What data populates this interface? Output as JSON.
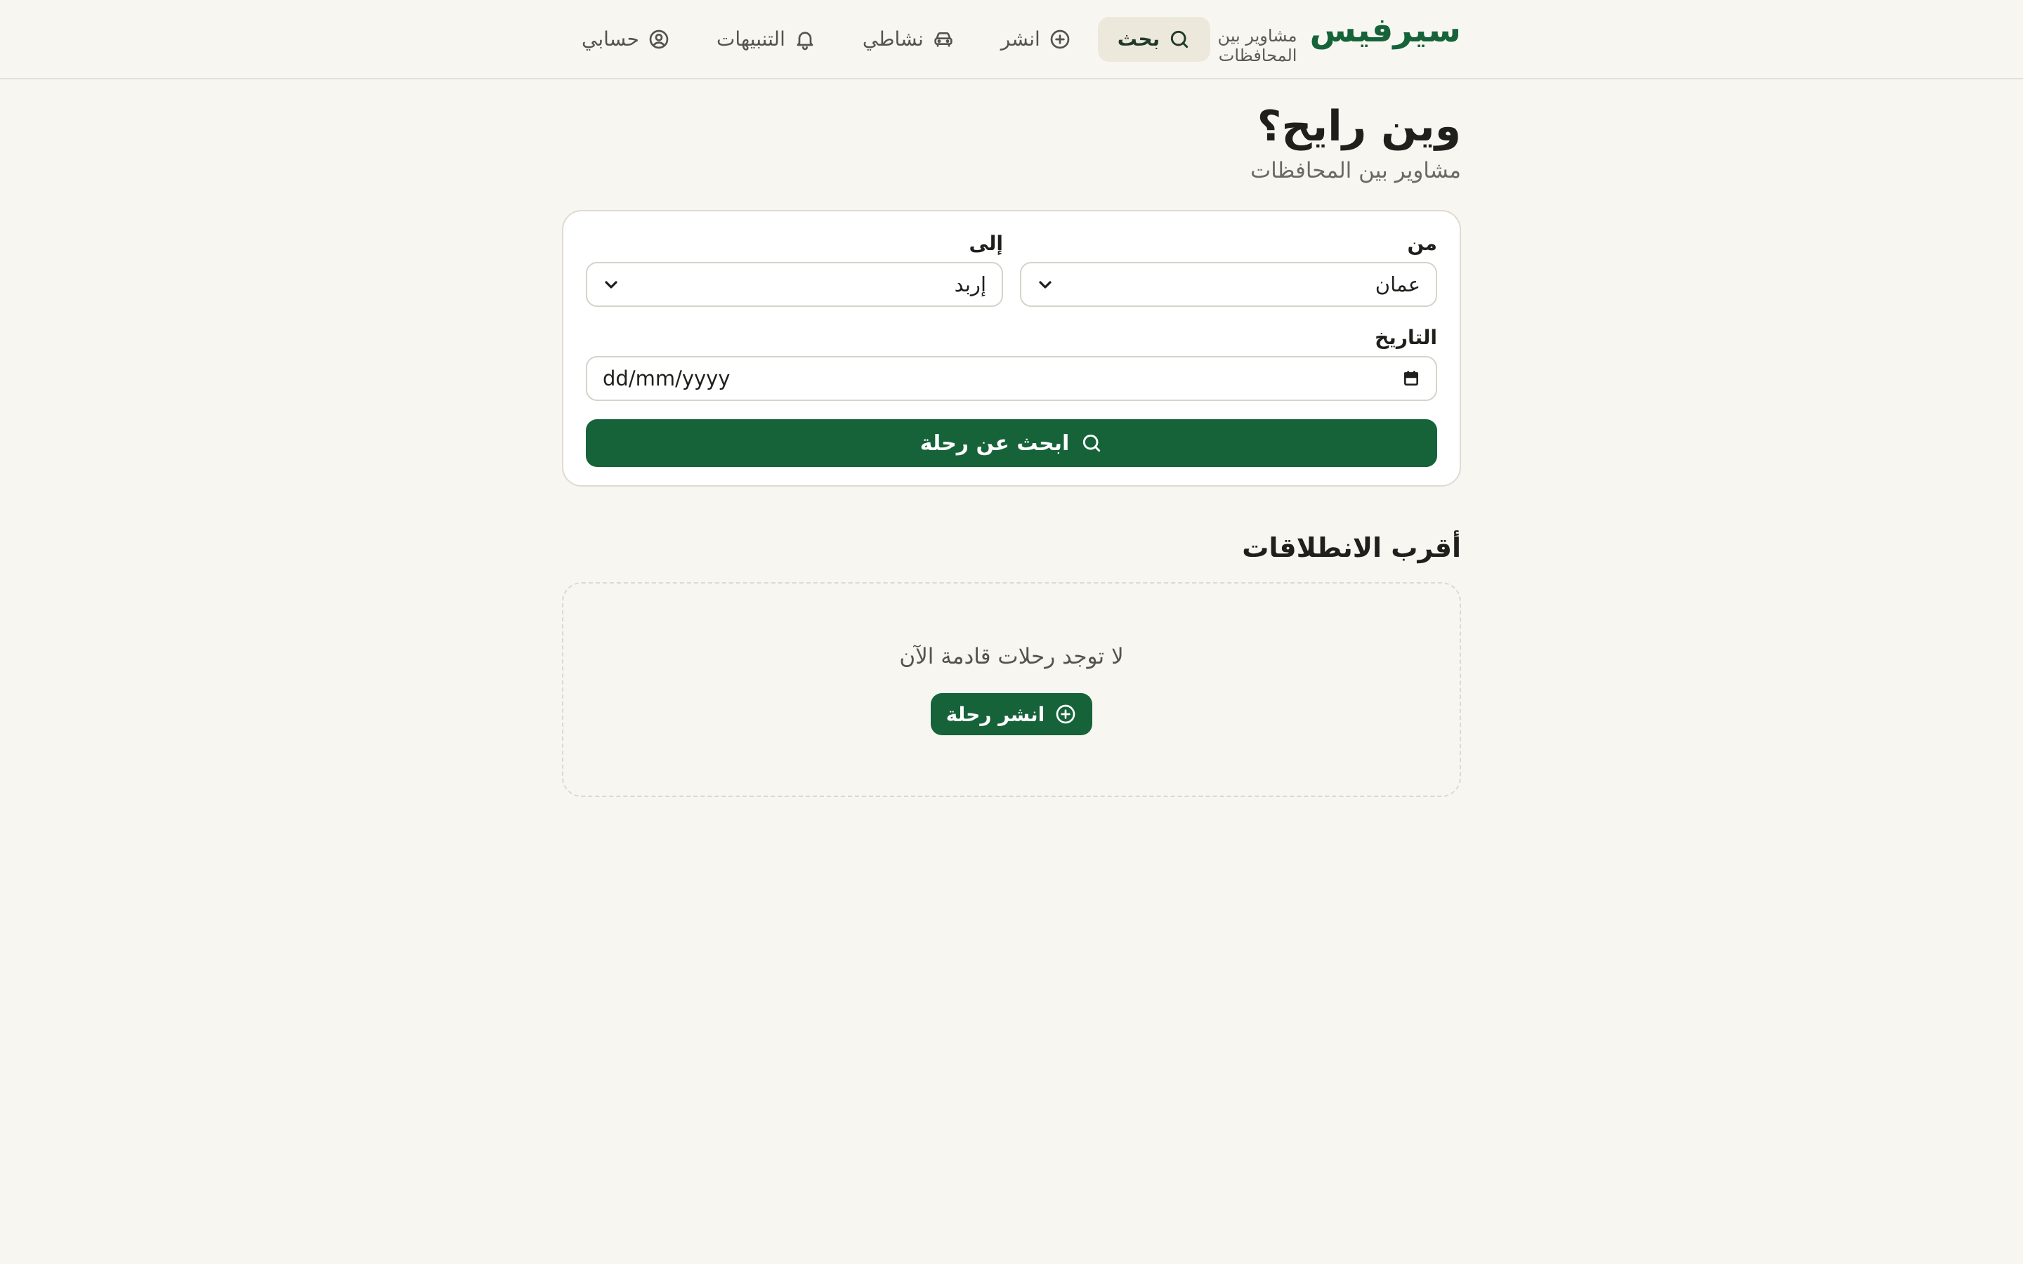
{
  "brand": {
    "name": "سيرفيس",
    "tagline": "مشاوير بين المحافظات",
    "color": "#16633a"
  },
  "nav": {
    "items": [
      {
        "label": "بحث",
        "icon": "search-icon",
        "active": true
      },
      {
        "label": "انشر",
        "icon": "plus-circle-icon",
        "active": false
      },
      {
        "label": "نشاطي",
        "icon": "car-icon",
        "active": false
      },
      {
        "label": "التنبيهات",
        "icon": "bell-icon",
        "active": false
      },
      {
        "label": "حسابي",
        "icon": "user-circle-icon",
        "active": false
      }
    ]
  },
  "page": {
    "title": "وين رايح؟",
    "subtitle": "مشاوير بين المحافظات"
  },
  "search": {
    "from_label": "من",
    "from_value": "عمان",
    "to_label": "إلى",
    "to_value": "إربد",
    "date_label": "التاريخ",
    "date_placeholder": "dd/mm/yyyy",
    "button_label": "ابحث عن رحلة"
  },
  "departures": {
    "title": "أقرب الانطلاقات",
    "empty_text": "لا توجد رحلات قادمة الآن",
    "publish_label": "انشر رحلة"
  }
}
